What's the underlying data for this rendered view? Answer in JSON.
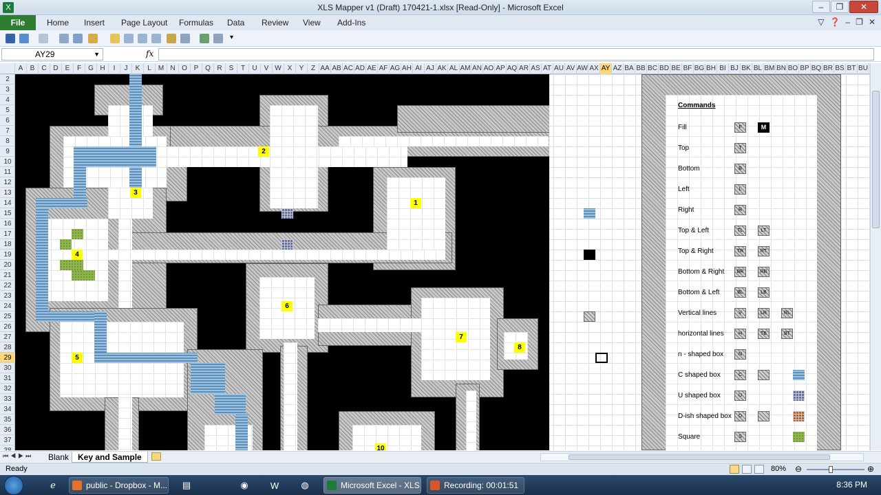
{
  "window": {
    "title": "XLS Mapper v1 (Draft) 170421-1.xlsx  [Read-Only]  -  Microsoft Excel"
  },
  "ribbon": {
    "file": "File",
    "tabs": [
      "Home",
      "Insert",
      "Page Layout",
      "Formulas",
      "Data",
      "Review",
      "View",
      "Add-Ins"
    ]
  },
  "formula_bar": {
    "name_box": "AY29",
    "fx": "fx",
    "value": ""
  },
  "columns": [
    "A",
    "B",
    "C",
    "D",
    "E",
    "F",
    "G",
    "H",
    "I",
    "J",
    "K",
    "L",
    "M",
    "N",
    "O",
    "P",
    "Q",
    "R",
    "S",
    "T",
    "U",
    "V",
    "W",
    "X",
    "Y",
    "Z",
    "AA",
    "AB",
    "AC",
    "AD",
    "AE",
    "AF",
    "AG",
    "AH",
    "AI",
    "AJ",
    "AK",
    "AL",
    "AM",
    "AN",
    "AO",
    "AP",
    "AQ",
    "AR",
    "AS",
    "AT",
    "AU",
    "AV",
    "AW",
    "AX",
    "AY",
    "AZ",
    "BA",
    "BB",
    "BC",
    "BD",
    "BE",
    "BF",
    "BG",
    "BH",
    "BI",
    "BJ",
    "BK",
    "BL",
    "BM",
    "BN",
    "BO",
    "BP",
    "BQ",
    "BR",
    "BS",
    "BT",
    "BU",
    "BV"
  ],
  "selected_column": "AY",
  "rows": [
    "2",
    "3",
    "4",
    "5",
    "6",
    "7",
    "8",
    "9",
    "10",
    "11",
    "12",
    "13",
    "14",
    "15",
    "16",
    "17",
    "18",
    "19",
    "20",
    "21",
    "22",
    "23",
    "24",
    "25",
    "26",
    "27",
    "28",
    "29",
    "30",
    "31",
    "32",
    "33",
    "34",
    "35",
    "36",
    "37",
    "38"
  ],
  "selected_row": "29",
  "map": {
    "room_numbers": [
      "1",
      "2",
      "3",
      "4",
      "5",
      "6",
      "7",
      "8",
      "10"
    ]
  },
  "legend": {
    "title": "Commands",
    "items": [
      {
        "label": "Fill",
        "codes": [
          "F"
        ],
        "extra": "M"
      },
      {
        "label": "Top",
        "codes": [
          "T"
        ]
      },
      {
        "label": "Bottom",
        "codes": [
          "B"
        ]
      },
      {
        "label": "Left",
        "codes": [
          "L"
        ]
      },
      {
        "label": "Right",
        "codes": [
          "R"
        ]
      },
      {
        "label": "Top & Left",
        "codes": [
          "TL",
          "LT"
        ]
      },
      {
        "label": "Top & Right",
        "codes": [
          "TR",
          "RT"
        ]
      },
      {
        "label": "Bottom & Right",
        "codes": [
          "BR",
          "RB"
        ]
      },
      {
        "label": "Bottom & Left",
        "codes": [
          "BL",
          "LB"
        ]
      },
      {
        "label": "Vertical lines",
        "codes": [
          "V",
          "LR",
          "RL"
        ]
      },
      {
        "label": "horizontal lines",
        "codes": [
          "H",
          "TB",
          "BT"
        ]
      },
      {
        "label": "n - shaped box",
        "codes": [
          "N"
        ]
      },
      {
        "label": "C shaped box",
        "codes": [
          "C",
          ""
        ]
      },
      {
        "label": "U shaped box",
        "codes": [
          "U"
        ]
      },
      {
        "label": "D-ish shaped box",
        "codes": [
          "D",
          ""
        ]
      },
      {
        "label": "Square",
        "codes": [
          "S"
        ]
      }
    ]
  },
  "sheets": [
    "Blank",
    "Key and Sample"
  ],
  "active_sheet": "Key and Sample",
  "status": {
    "ready": "Ready",
    "zoom": "80%"
  },
  "taskbar": {
    "items": [
      "public - Dropbox - M...",
      "Microsoft Excel - XLS...",
      "Recording:  00:01:51"
    ],
    "clock": "8:36 PM"
  },
  "colors": {
    "file_tab": "#2e7d32",
    "selection_highlight": "#fbd97b",
    "room_label": "#ffff00",
    "water": "#6ea0c8",
    "grass": "#8fb54e"
  }
}
